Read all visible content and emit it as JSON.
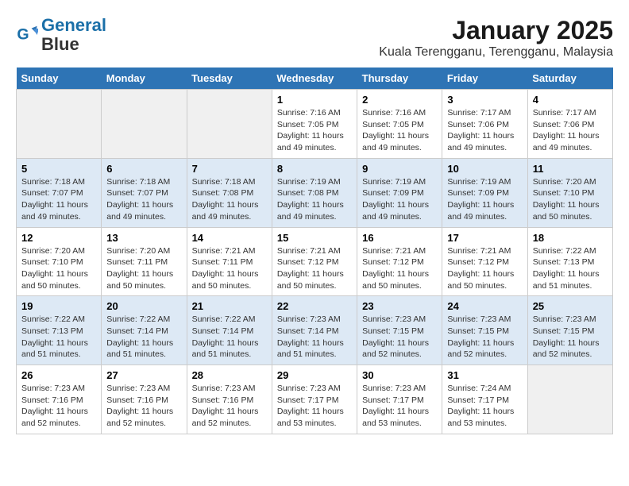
{
  "header": {
    "logo_line1": "General",
    "logo_line2": "Blue",
    "title": "January 2025",
    "subtitle": "Kuala Terengganu, Terengganu, Malaysia"
  },
  "weekdays": [
    "Sunday",
    "Monday",
    "Tuesday",
    "Wednesday",
    "Thursday",
    "Friday",
    "Saturday"
  ],
  "weeks": [
    [
      {
        "day": "",
        "info": ""
      },
      {
        "day": "",
        "info": ""
      },
      {
        "day": "",
        "info": ""
      },
      {
        "day": "1",
        "info": "Sunrise: 7:16 AM\nSunset: 7:05 PM\nDaylight: 11 hours and 49 minutes."
      },
      {
        "day": "2",
        "info": "Sunrise: 7:16 AM\nSunset: 7:05 PM\nDaylight: 11 hours and 49 minutes."
      },
      {
        "day": "3",
        "info": "Sunrise: 7:17 AM\nSunset: 7:06 PM\nDaylight: 11 hours and 49 minutes."
      },
      {
        "day": "4",
        "info": "Sunrise: 7:17 AM\nSunset: 7:06 PM\nDaylight: 11 hours and 49 minutes."
      }
    ],
    [
      {
        "day": "5",
        "info": "Sunrise: 7:18 AM\nSunset: 7:07 PM\nDaylight: 11 hours and 49 minutes."
      },
      {
        "day": "6",
        "info": "Sunrise: 7:18 AM\nSunset: 7:07 PM\nDaylight: 11 hours and 49 minutes."
      },
      {
        "day": "7",
        "info": "Sunrise: 7:18 AM\nSunset: 7:08 PM\nDaylight: 11 hours and 49 minutes."
      },
      {
        "day": "8",
        "info": "Sunrise: 7:19 AM\nSunset: 7:08 PM\nDaylight: 11 hours and 49 minutes."
      },
      {
        "day": "9",
        "info": "Sunrise: 7:19 AM\nSunset: 7:09 PM\nDaylight: 11 hours and 49 minutes."
      },
      {
        "day": "10",
        "info": "Sunrise: 7:19 AM\nSunset: 7:09 PM\nDaylight: 11 hours and 49 minutes."
      },
      {
        "day": "11",
        "info": "Sunrise: 7:20 AM\nSunset: 7:10 PM\nDaylight: 11 hours and 50 minutes."
      }
    ],
    [
      {
        "day": "12",
        "info": "Sunrise: 7:20 AM\nSunset: 7:10 PM\nDaylight: 11 hours and 50 minutes."
      },
      {
        "day": "13",
        "info": "Sunrise: 7:20 AM\nSunset: 7:11 PM\nDaylight: 11 hours and 50 minutes."
      },
      {
        "day": "14",
        "info": "Sunrise: 7:21 AM\nSunset: 7:11 PM\nDaylight: 11 hours and 50 minutes."
      },
      {
        "day": "15",
        "info": "Sunrise: 7:21 AM\nSunset: 7:12 PM\nDaylight: 11 hours and 50 minutes."
      },
      {
        "day": "16",
        "info": "Sunrise: 7:21 AM\nSunset: 7:12 PM\nDaylight: 11 hours and 50 minutes."
      },
      {
        "day": "17",
        "info": "Sunrise: 7:21 AM\nSunset: 7:12 PM\nDaylight: 11 hours and 50 minutes."
      },
      {
        "day": "18",
        "info": "Sunrise: 7:22 AM\nSunset: 7:13 PM\nDaylight: 11 hours and 51 minutes."
      }
    ],
    [
      {
        "day": "19",
        "info": "Sunrise: 7:22 AM\nSunset: 7:13 PM\nDaylight: 11 hours and 51 minutes."
      },
      {
        "day": "20",
        "info": "Sunrise: 7:22 AM\nSunset: 7:14 PM\nDaylight: 11 hours and 51 minutes."
      },
      {
        "day": "21",
        "info": "Sunrise: 7:22 AM\nSunset: 7:14 PM\nDaylight: 11 hours and 51 minutes."
      },
      {
        "day": "22",
        "info": "Sunrise: 7:23 AM\nSunset: 7:14 PM\nDaylight: 11 hours and 51 minutes."
      },
      {
        "day": "23",
        "info": "Sunrise: 7:23 AM\nSunset: 7:15 PM\nDaylight: 11 hours and 52 minutes."
      },
      {
        "day": "24",
        "info": "Sunrise: 7:23 AM\nSunset: 7:15 PM\nDaylight: 11 hours and 52 minutes."
      },
      {
        "day": "25",
        "info": "Sunrise: 7:23 AM\nSunset: 7:15 PM\nDaylight: 11 hours and 52 minutes."
      }
    ],
    [
      {
        "day": "26",
        "info": "Sunrise: 7:23 AM\nSunset: 7:16 PM\nDaylight: 11 hours and 52 minutes."
      },
      {
        "day": "27",
        "info": "Sunrise: 7:23 AM\nSunset: 7:16 PM\nDaylight: 11 hours and 52 minutes."
      },
      {
        "day": "28",
        "info": "Sunrise: 7:23 AM\nSunset: 7:16 PM\nDaylight: 11 hours and 52 minutes."
      },
      {
        "day": "29",
        "info": "Sunrise: 7:23 AM\nSunset: 7:17 PM\nDaylight: 11 hours and 53 minutes."
      },
      {
        "day": "30",
        "info": "Sunrise: 7:23 AM\nSunset: 7:17 PM\nDaylight: 11 hours and 53 minutes."
      },
      {
        "day": "31",
        "info": "Sunrise: 7:24 AM\nSunset: 7:17 PM\nDaylight: 11 hours and 53 minutes."
      },
      {
        "day": "",
        "info": ""
      }
    ]
  ]
}
